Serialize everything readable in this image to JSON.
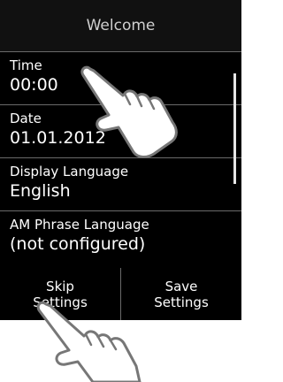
{
  "screen": {
    "title": "Welcome"
  },
  "settings": [
    {
      "label": "Time",
      "value": "00:00"
    },
    {
      "label": "Date",
      "value": "01.01.2012"
    },
    {
      "label": "Display Language",
      "value": "English"
    },
    {
      "label": "AM Phrase Language",
      "value": "(not configured)"
    }
  ],
  "softkeys": {
    "left": "Skip Settings",
    "right": "Save Settings"
  },
  "icons": {
    "touch_hand_top": "pointing-hand-icon",
    "touch_hand_bottom": "pointing-hand-icon"
  },
  "colors": {
    "screen_background": "#000000",
    "title_background": "#111111",
    "text": "#ffffff",
    "divider": "#6a6a6a"
  }
}
